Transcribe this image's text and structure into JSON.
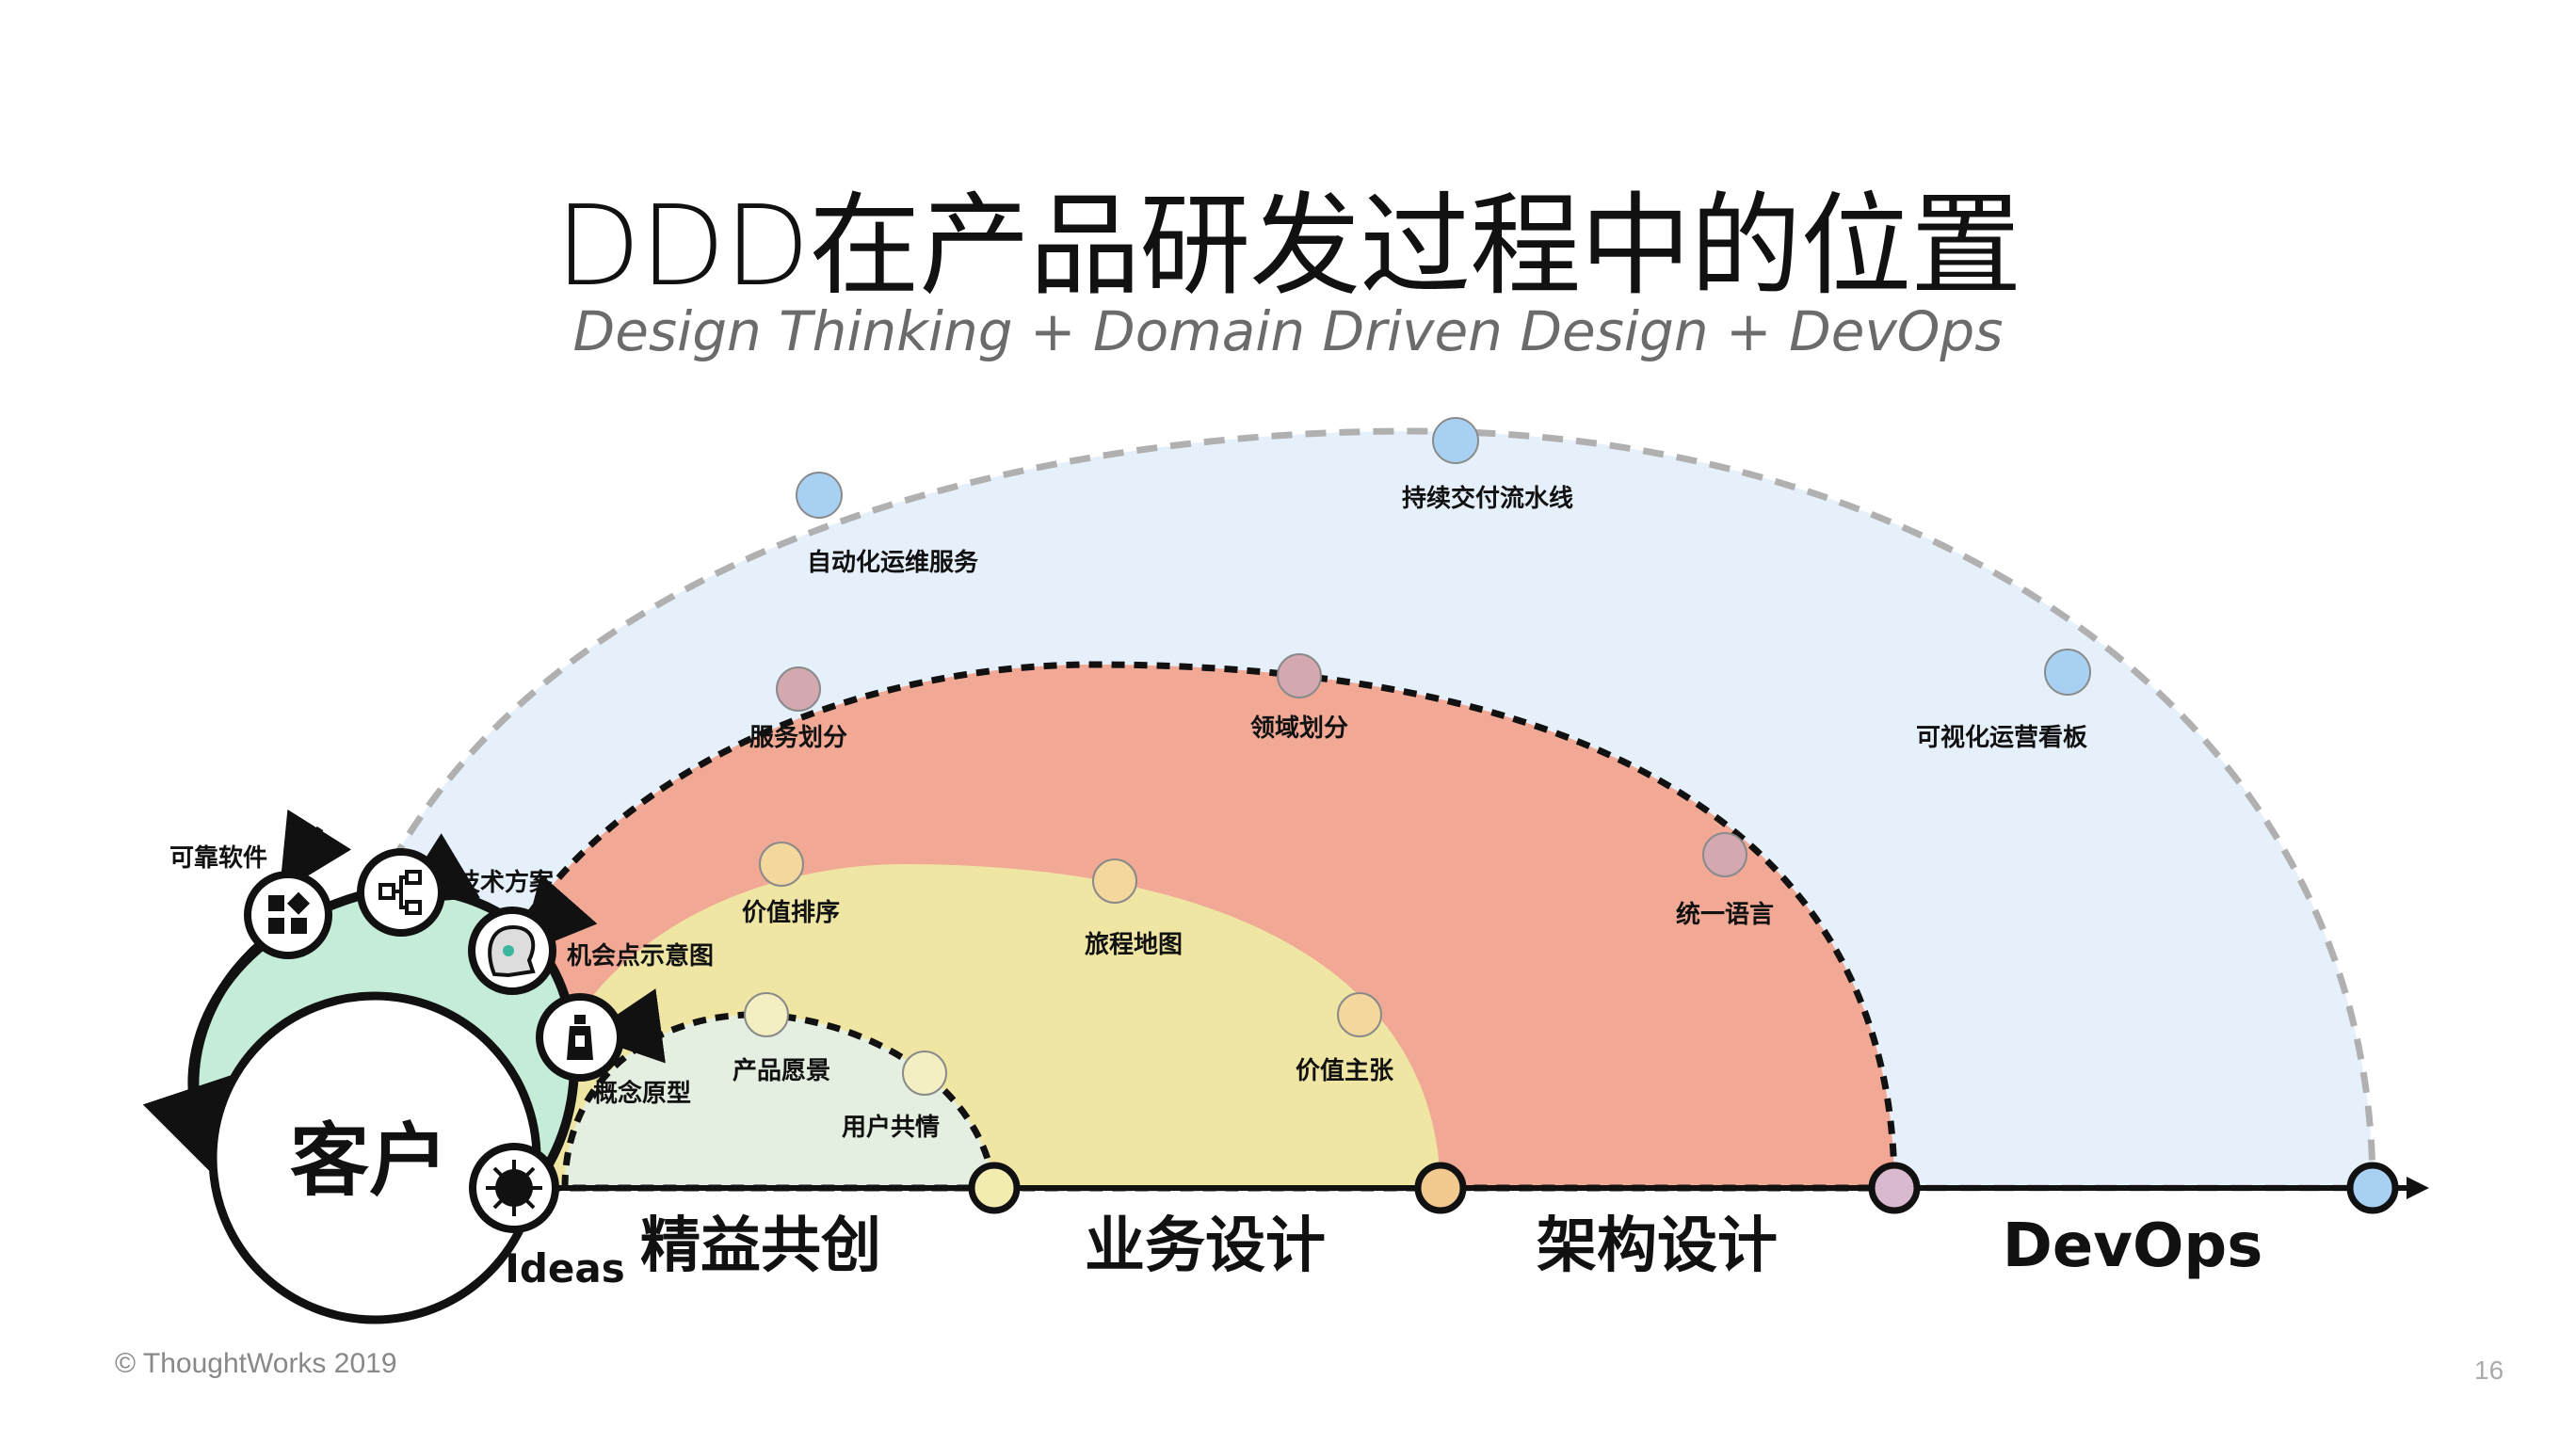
{
  "title": "DDD在产品研发过程中的位置",
  "subtitle": "Design Thinking + Domain Driven Design + DevOps",
  "footer": {
    "copyright": "© ThoughtWorks 2019",
    "page_number": "16"
  },
  "colors": {
    "devops_fill": "#e6f0fa",
    "architecture_fill": "#f1a995",
    "business_fill": "#f0e6a4",
    "lean_fill": "#e4efe1",
    "customer_ring": "#c5ecd8",
    "blue_dot": "#a8d0f2",
    "axis": "#111111"
  },
  "center": {
    "label": "客户",
    "ideas_label": "Ideas"
  },
  "stages": [
    {
      "id": "lean",
      "label": "精益共创"
    },
    {
      "id": "business",
      "label": "业务设计"
    },
    {
      "id": "architecture",
      "label": "架构设计"
    },
    {
      "id": "devops",
      "label": "DevOps"
    }
  ],
  "arc_nodes": {
    "devops": [
      "自动化运维服务",
      "持续交付流水线",
      "可视化运营看板"
    ],
    "architecture": [
      "服务划分",
      "领域划分",
      "统一语言"
    ],
    "business": [
      "价值排序",
      "旅程地图",
      "价值主张"
    ],
    "lean": [
      "产品愿景",
      "用户共情"
    ]
  },
  "outputs": [
    {
      "label": "可靠软件",
      "icon": "app-grid-icon"
    },
    {
      "label": "技术方案",
      "icon": "hierarchy-icon"
    },
    {
      "label": "机会点示意图",
      "icon": "head-idea-icon"
    },
    {
      "label": "概念原型",
      "icon": "bottle-icon"
    }
  ]
}
